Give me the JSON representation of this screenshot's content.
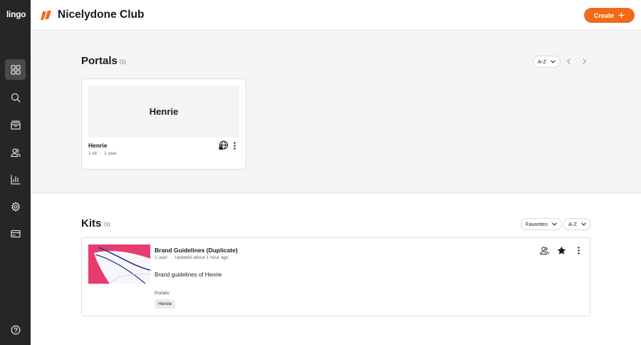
{
  "app": {
    "logo": "lingo"
  },
  "header": {
    "title": "Nicelydone Club",
    "create_label": "Create"
  },
  "colors": {
    "accent": "#f26a17",
    "sidebar": "#262626",
    "kit_thumb": "#e83c6f"
  },
  "sidebar": {
    "items": [
      {
        "name": "dashboard-icon",
        "active": true
      },
      {
        "name": "search-icon"
      },
      {
        "name": "kits-icon"
      },
      {
        "name": "users-icon"
      },
      {
        "name": "analytics-icon"
      },
      {
        "name": "settings-icon"
      },
      {
        "name": "billing-icon"
      },
      {
        "name": "help-icon"
      }
    ]
  },
  "portals": {
    "title": "Portals",
    "count": "(1)",
    "sort": "A-Z",
    "items": [
      {
        "thumb_title": "Henrie",
        "name": "Henrie",
        "kits": "1 kit",
        "users": "1 user"
      }
    ]
  },
  "kits": {
    "title": "Kits",
    "count": "(1)",
    "filter": "Favorites",
    "sort": "A-Z",
    "items": [
      {
        "title": "Brand Guidelines (Duplicate)",
        "users": "1 user",
        "updated": "Updated about 1 hour ago",
        "description": "Brand guidelines of Henrie",
        "portals_label": "Portals:",
        "portal_tag": "Henrie"
      }
    ]
  }
}
